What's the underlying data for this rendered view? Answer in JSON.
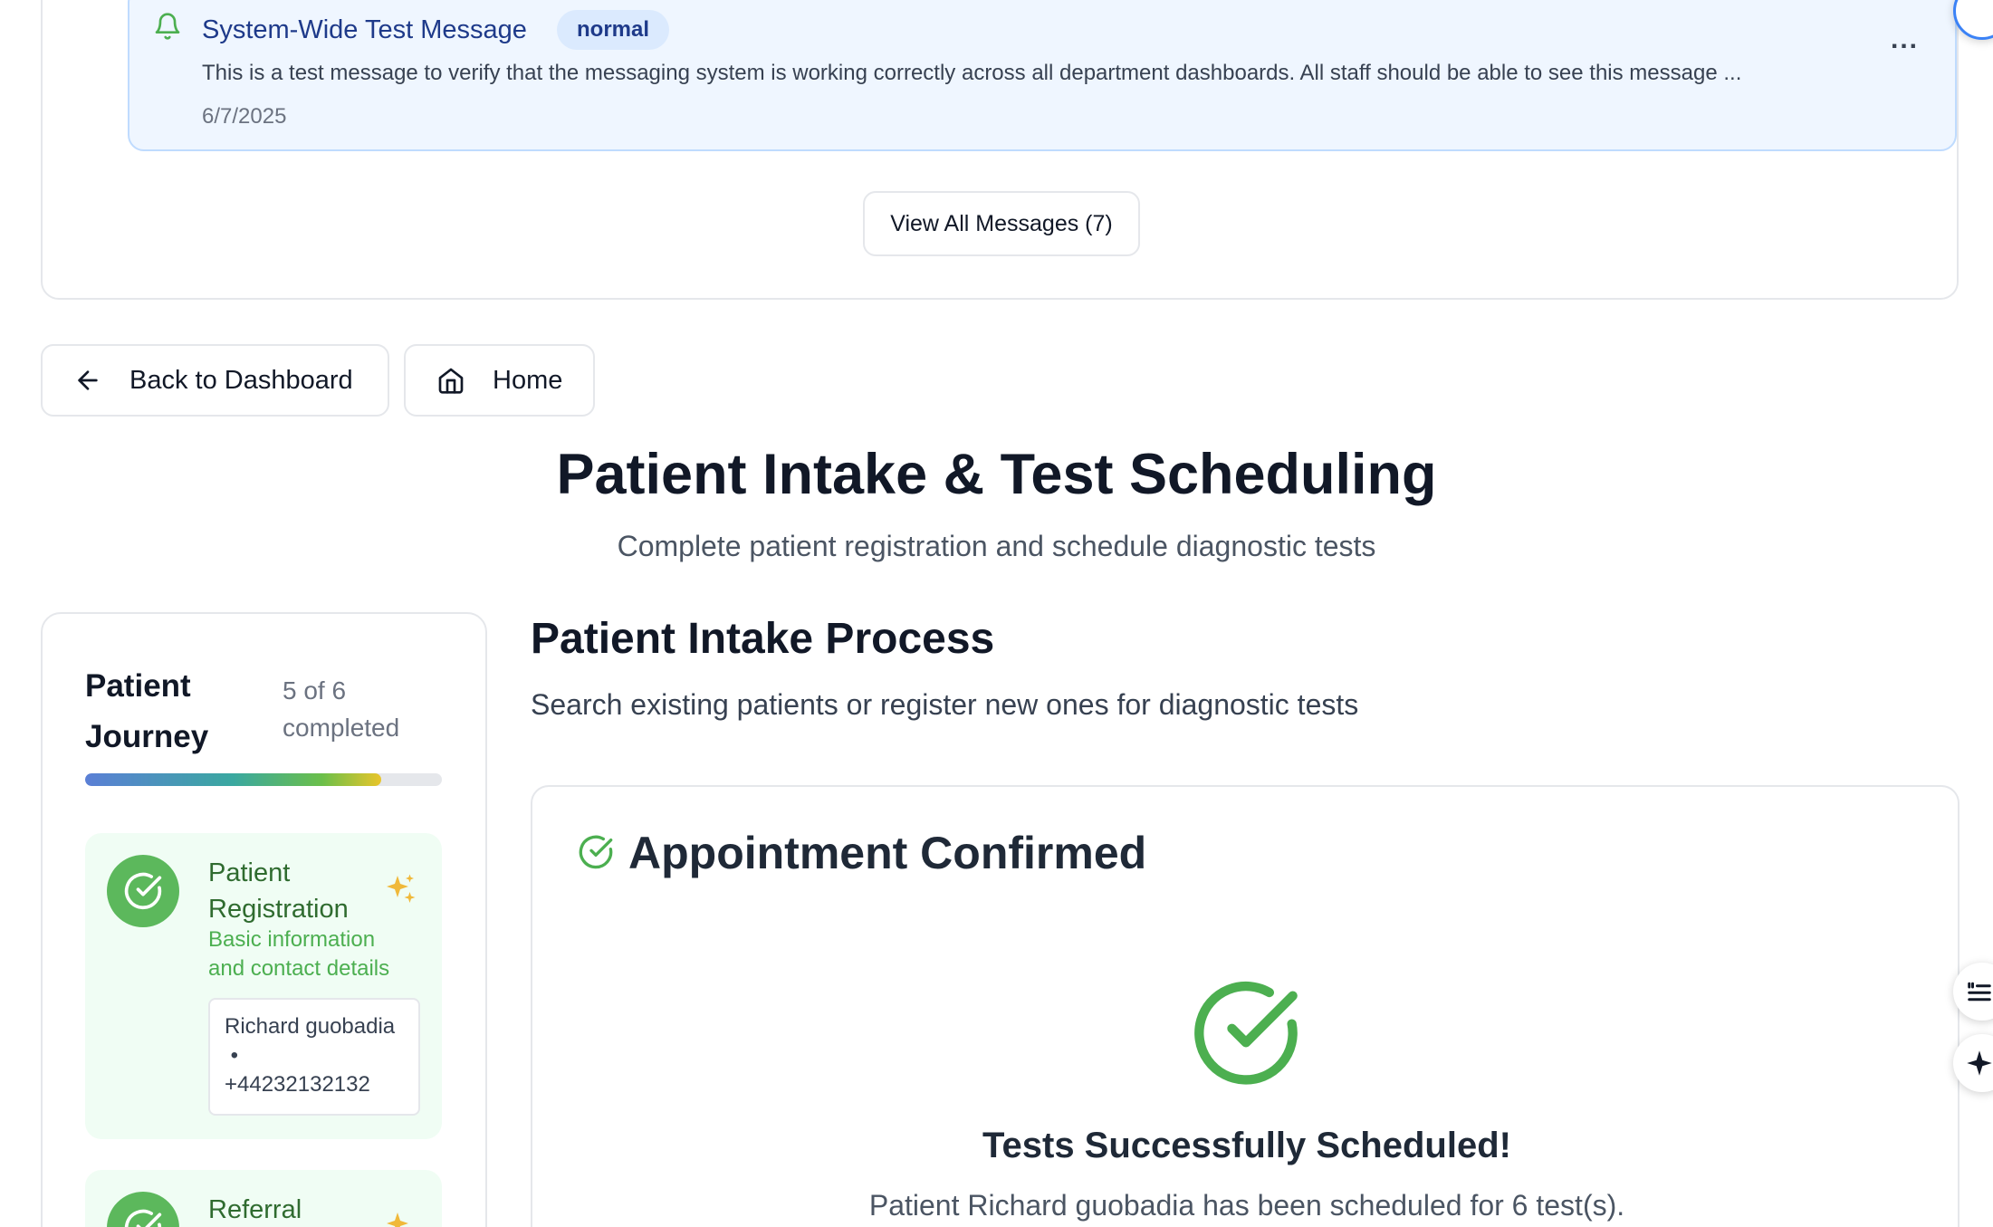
{
  "messages": {
    "item": {
      "title": "System-Wide Test Message",
      "badge": "normal",
      "body": "This is a test message to verify that the messaging system is working correctly across all department dashboards. All staff should be able to see this message ...",
      "date": "6/7/2025",
      "more": "..."
    },
    "view_all_label": "View All Messages (7)"
  },
  "nav": {
    "back_label": "Back to Dashboard",
    "home_label": "Home"
  },
  "page": {
    "title": "Patient Intake & Test Scheduling",
    "subtitle": "Complete patient registration and schedule diagnostic tests"
  },
  "journey": {
    "title": "Patient Journey",
    "count": "5 of 6 completed",
    "progress": 0.83,
    "colors": {
      "start": "#5b7fd6",
      "end": "#e9c52a",
      "track": "#e5e7eb"
    },
    "steps": [
      {
        "title": "Patient Registration",
        "description": "Basic information and contact details",
        "patient_name": "Richard guobadia",
        "patient_phone": "+44232132132",
        "icon": "check-circle-icon"
      },
      {
        "title": "Referral",
        "icon": "check-circle-icon"
      }
    ]
  },
  "main": {
    "section_title": "Patient Intake Process",
    "section_desc": "Search existing patients or register new ones for diagnostic tests",
    "confirm": {
      "heading": "Appointment Confirmed",
      "success_title": "Tests Successfully Scheduled!",
      "success_desc": "Patient Richard guobadia has been scheduled for 6 test(s)."
    }
  },
  "colors": {
    "success": "#4caf50",
    "info_bg": "#eff6ff",
    "info_border": "#bfdbfe",
    "sparkle": "#f0b93a"
  }
}
